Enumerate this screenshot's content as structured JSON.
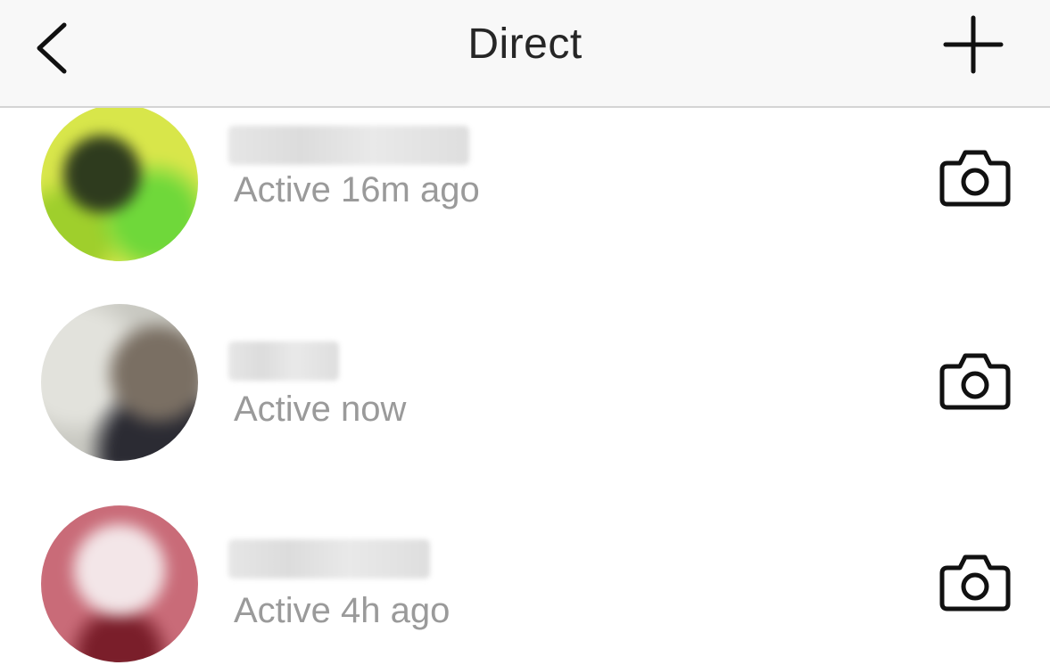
{
  "header": {
    "title": "Direct",
    "back_icon": "chevron-left-icon",
    "add_icon": "plus-icon"
  },
  "threads": [
    {
      "status": "Active 16m ago",
      "action_icon": "camera-icon",
      "avatar_colors": [
        "#d8e64a",
        "#2e3b1e",
        "#6fd83a"
      ]
    },
    {
      "status": "Active now",
      "action_icon": "camera-icon",
      "avatar_colors": [
        "#c9c9c2",
        "#7a6f63",
        "#2b2b33"
      ]
    },
    {
      "status": "Active 4h ago",
      "action_icon": "camera-icon",
      "avatar_colors": [
        "#c96b78",
        "#f3e6e8",
        "#7a1e2a"
      ]
    }
  ],
  "colors": {
    "header_bg": "#f8f8f8",
    "title_text": "#262626",
    "status_text": "#9a9a9a",
    "icon_stroke": "#111111"
  }
}
